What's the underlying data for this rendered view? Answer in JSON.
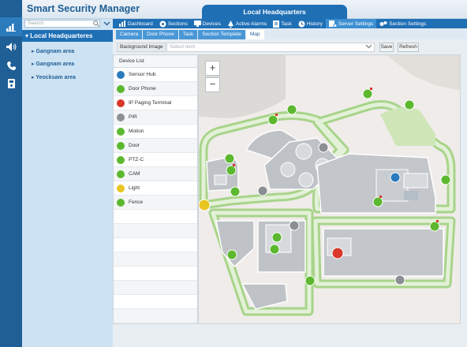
{
  "app": {
    "title": "Smart Security Manager",
    "site_tab": "Local Headquarters"
  },
  "sidebar": {
    "search_placeholder": "Search",
    "root": "Local Headquarteres",
    "items": [
      {
        "label": "Gangnam area"
      },
      {
        "label": "Gangnam area"
      },
      {
        "label": "Yeocksam area"
      }
    ]
  },
  "menu": {
    "items": [
      {
        "label": "Dashboard",
        "icon": "dashboard-icon"
      },
      {
        "label": "Sections",
        "icon": "sections-icon"
      },
      {
        "label": "Devices",
        "icon": "devices-icon"
      },
      {
        "label": "Active Alarms",
        "icon": "alarm-icon"
      },
      {
        "label": "Task",
        "icon": "task-icon"
      },
      {
        "label": "History",
        "icon": "history-icon"
      },
      {
        "label": "Server Settings",
        "icon": "server-settings-icon"
      },
      {
        "label": "Section Settings",
        "icon": "section-settings-icon"
      }
    ]
  },
  "subtabs": [
    "Camera",
    "Door Phone",
    "Task",
    "Section Template",
    "Map"
  ],
  "background": {
    "label": "Background Image",
    "placeholder": "Select item",
    "save": "Save",
    "refresh": "Refresh"
  },
  "device_list": {
    "header": "Device List",
    "items": [
      {
        "label": "Sensor Hub",
        "color": "#2b7bbd"
      },
      {
        "label": "Door Phone",
        "color": "#5cb82e"
      },
      {
        "label": "IP Paging Terminal",
        "color": "#d8372a"
      },
      {
        "label": "PIR",
        "color": "#8b8f93"
      },
      {
        "label": "Motion",
        "color": "#5cb82e"
      },
      {
        "label": "Door",
        "color": "#5cb82e"
      },
      {
        "label": "PTZ-C",
        "color": "#5cb82e"
      },
      {
        "label": "CAM",
        "color": "#5cb82e"
      },
      {
        "label": "Light",
        "color": "#e8c520"
      },
      {
        "label": "Fence",
        "color": "#5cb82e"
      }
    ]
  },
  "map": {
    "zoom_in": "+",
    "zoom_out": "−"
  }
}
